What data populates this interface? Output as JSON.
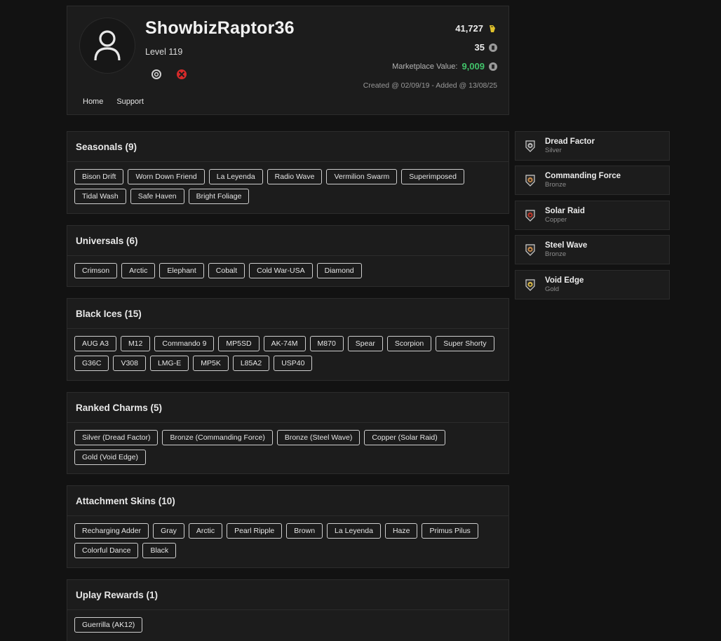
{
  "profile": {
    "username": "ShowbizRaptor36",
    "level": "Level 119",
    "credits": "41,727",
    "r6credits": "35",
    "marketplace_label": "Marketplace Value:",
    "marketplace_value": "9,009",
    "created": "Created @ 02/09/19 - Added @ 13/08/25",
    "nav": [
      "Home",
      "Support"
    ],
    "platforms": [
      "ubisoft-icon",
      "xbox-icon"
    ]
  },
  "sections": [
    {
      "title": "Seasonals (9)",
      "items": [
        "Bison Drift",
        "Worn Down Friend",
        "La Leyenda",
        "Radio Wave",
        "Vermilion Swarm",
        "Superimposed",
        "Tidal Wash",
        "Safe Haven",
        "Bright Foliage"
      ]
    },
    {
      "title": "Universals (6)",
      "items": [
        "Crimson",
        "Arctic",
        "Elephant",
        "Cobalt",
        "Cold War-USA",
        "Diamond"
      ]
    },
    {
      "title": "Black Ices (15)",
      "items": [
        "AUG A3",
        "M12",
        "Commando 9",
        "MP5SD",
        "AK-74M",
        "M870",
        "Spear",
        "Scorpion",
        "Super Shorty",
        "G36C",
        "V308",
        "LMG-E",
        "MP5K",
        "L85A2",
        "USP40"
      ]
    },
    {
      "title": "Ranked Charms (5)",
      "items": [
        "Silver (Dread Factor)",
        "Bronze (Commanding Force)",
        "Bronze (Steel Wave)",
        "Copper (Solar Raid)",
        "Gold (Void Edge)"
      ]
    },
    {
      "title": "Attachment Skins (10)",
      "items": [
        "Recharging Adder",
        "Gray",
        "Arctic",
        "Pearl Ripple",
        "Brown",
        "La Leyenda",
        "Haze",
        "Primus Pilus",
        "Colorful Dance",
        "Black"
      ]
    },
    {
      "title": "Uplay Rewards (1)",
      "items": [
        "Guerrilla (AK12)"
      ]
    }
  ],
  "charms": [
    {
      "name": "Dread Factor",
      "tier": "Silver",
      "color": "#b9b9b9"
    },
    {
      "name": "Commanding Force",
      "tier": "Bronze",
      "color": "#c98a4a"
    },
    {
      "name": "Solar Raid",
      "tier": "Copper",
      "color": "#c0392b"
    },
    {
      "name": "Steel Wave",
      "tier": "Bronze",
      "color": "#c98a4a"
    },
    {
      "name": "Void Edge",
      "tier": "Gold",
      "color": "#d8b84a"
    }
  ],
  "colors": {
    "accent_green": "#41c36a",
    "background": "#121212",
    "card": "#1c1c1c"
  }
}
